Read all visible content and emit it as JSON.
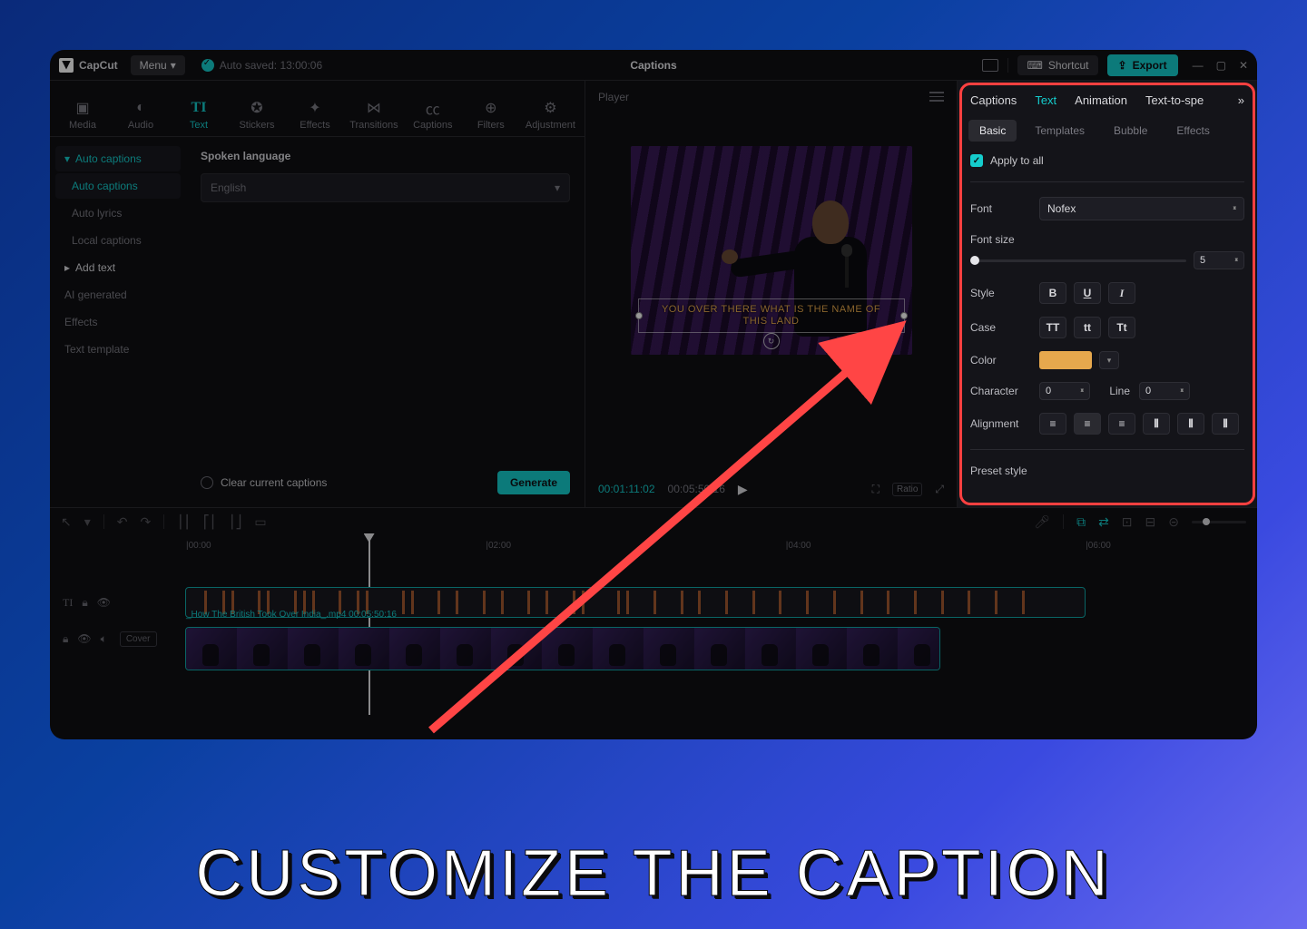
{
  "annotation": {
    "headline": "CUSTOMIZE THE CAPTION"
  },
  "titlebar": {
    "app_name": "CapCut",
    "menu_label": "Menu",
    "autosave": "Auto saved: 13:00:06",
    "title": "Captions",
    "shortcut_label": "Shortcut",
    "export_label": "Export"
  },
  "tooltabs": {
    "media": "Media",
    "audio": "Audio",
    "text": "Text",
    "stickers": "Stickers",
    "effects": "Effects",
    "transitions": "Transitions",
    "captions": "Captions",
    "filters": "Filters",
    "adjustment": "Adjustment"
  },
  "sidebar": {
    "auto_captions_group": "Auto captions",
    "auto_captions": "Auto captions",
    "auto_lyrics": "Auto lyrics",
    "local_captions": "Local captions",
    "add_text_group": "Add text",
    "ai_generated": "AI generated",
    "effects": "Effects",
    "text_template": "Text template"
  },
  "settings": {
    "lang_label": "Spoken language",
    "lang_value": "English",
    "clear_label": "Clear current captions",
    "generate_label": "Generate"
  },
  "player": {
    "title": "Player",
    "current_time": "00:01:11:02",
    "total_time": "00:05:50:16",
    "caption_line1": "YOU OVER THERE WHAT IS THE NAME OF",
    "caption_line2": "THIS LAND",
    "ratio_label": "Ratio"
  },
  "props": {
    "tabs": {
      "captions": "Captions",
      "text": "Text",
      "animation": "Animation",
      "tts": "Text-to-spe"
    },
    "subtabs": {
      "basic": "Basic",
      "templates": "Templates",
      "bubble": "Bubble",
      "effects": "Effects"
    },
    "apply_all": "Apply to all",
    "font_label": "Font",
    "font_value": "Nofex",
    "fontsize_label": "Font size",
    "fontsize_value": "5",
    "style_label": "Style",
    "style_bold": "B",
    "style_underline": "U",
    "style_italic": "I",
    "case_label": "Case",
    "case_upper": "TT",
    "case_lower": "tt",
    "case_title": "Tt",
    "color_label": "Color",
    "color_hex": "#e6a84d",
    "character_label": "Character",
    "character_value": "0",
    "line_label": "Line",
    "line_value": "0",
    "alignment_label": "Alignment",
    "preset_label": "Preset style"
  },
  "timeline": {
    "ticks": [
      "|00:00",
      "|02:00",
      "|04:00",
      "|06:00"
    ],
    "clip_title": "_How The British Took Over India_.mp4  00:05:50:16",
    "cover_label": "Cover"
  }
}
